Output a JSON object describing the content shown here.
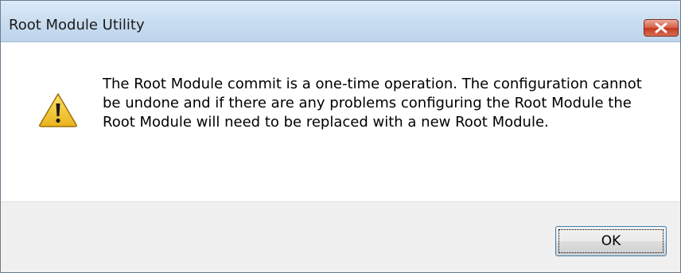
{
  "window": {
    "title": "Root Module Utility",
    "close_icon": "close-x-icon"
  },
  "dialog": {
    "icon": "warning-icon",
    "message": "The Root Module commit is a one-time operation.  The configuration cannot be undone and if there are any problems configuring the Root Module the Root Module will need to be replaced with a new Root Module."
  },
  "buttons": {
    "ok_label": "OK"
  },
  "colors": {
    "titlebar": "#c8dcf0",
    "close_button": "#c4371d",
    "warning_yellow": "#f5c518",
    "button_bar": "#f0f0f0",
    "ok_border": "#3c7fb1"
  }
}
